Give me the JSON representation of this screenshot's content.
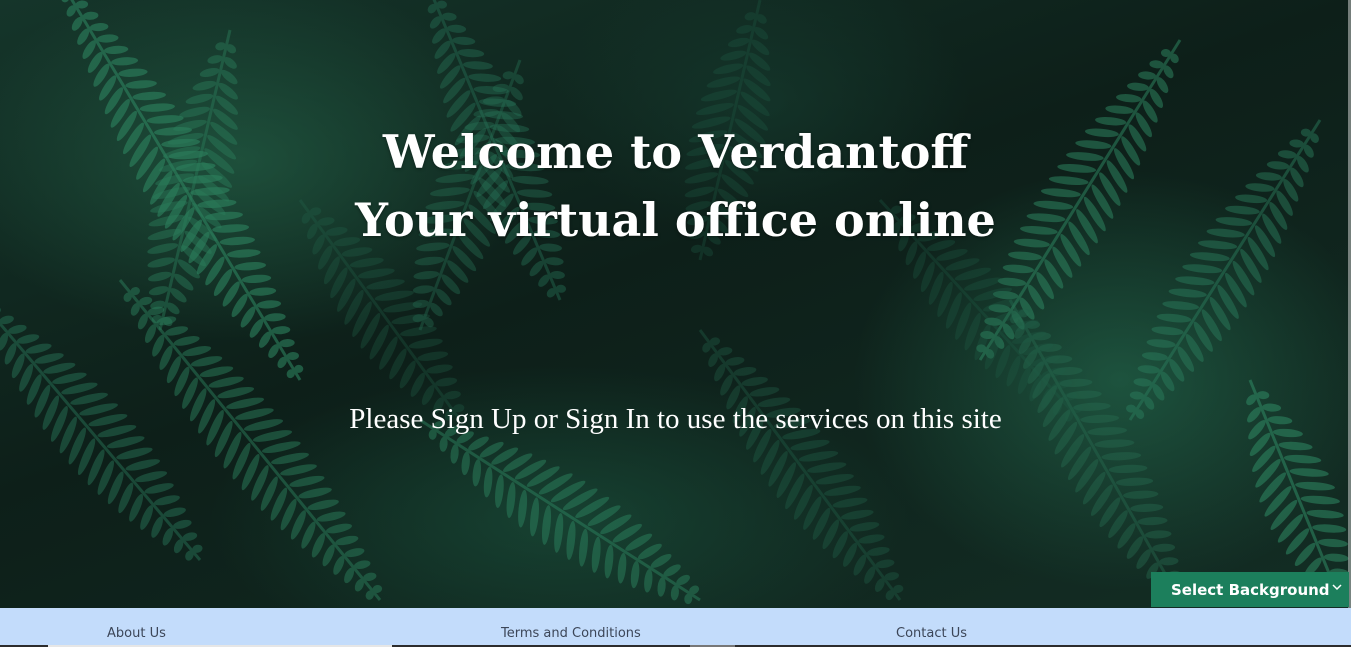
{
  "hero": {
    "title_line1": "Welcome to Verdantoff",
    "title_line2": "Your virtual office online",
    "subtitle": "Please Sign Up or Sign In to use the services on this site"
  },
  "background_selector": {
    "label": "Select Background",
    "icon": "chevron-down-icon"
  },
  "footer": {
    "about": "About Us",
    "terms": "Terms and Conditions",
    "contact": "Contact Us"
  },
  "colors": {
    "accent_button": "#1c7f5c",
    "footer_bg": "#c3dcfb",
    "hero_text": "#ffffff",
    "fern_green": "#2f8a64"
  }
}
